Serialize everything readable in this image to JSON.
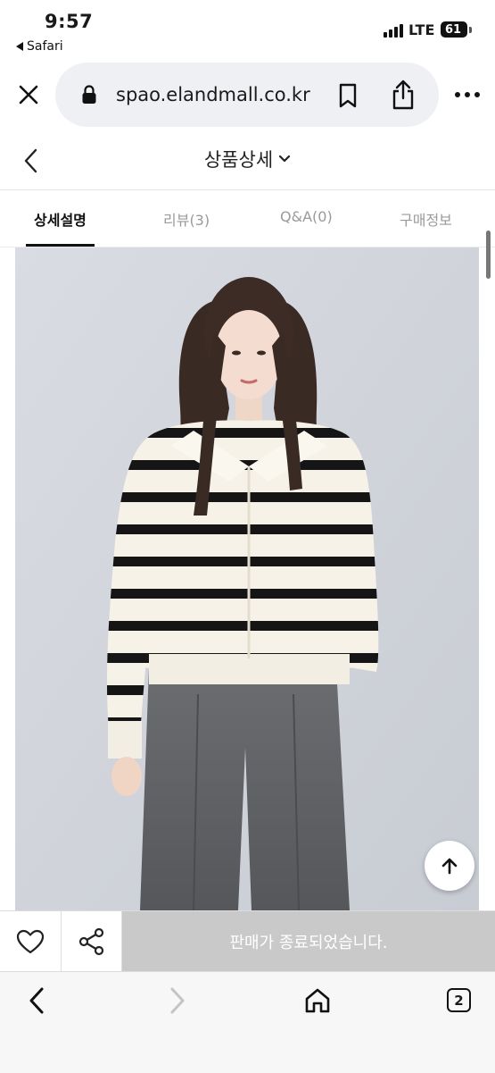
{
  "status_bar": {
    "time": "9:57",
    "back_app_label": "Safari",
    "network": "LTE",
    "battery": "61"
  },
  "browser": {
    "url": "spao.elandmall.co.kr",
    "tab_count": "2"
  },
  "page": {
    "title": "상품상세"
  },
  "tabs": [
    {
      "label": "상세설명",
      "active": true
    },
    {
      "label": "리뷰(3)",
      "active": false
    },
    {
      "label": "Q&A(0)",
      "active": false
    },
    {
      "label": "구매정보",
      "active": false
    }
  ],
  "purchase_bar": {
    "status_label": "판매가 종료되었습니다."
  },
  "icons": {
    "close": "close-icon",
    "lock": "lock-icon",
    "bookmark": "bookmark-icon",
    "share": "share-icon",
    "more": "more-icon",
    "back": "chevron-left-icon",
    "dropdown": "chevron-down-icon",
    "scroll_top": "arrow-up-icon",
    "wishlist": "heart-icon",
    "product_share": "share-nodes-icon",
    "home": "home-icon"
  }
}
